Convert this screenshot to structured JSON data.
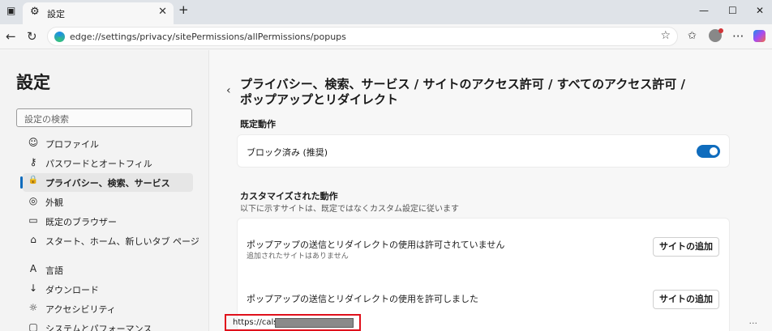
{
  "browser": {
    "tab_title": "設定",
    "tab_close": "✕",
    "new_tab": "+",
    "url": "edge://settings/privacy/sitePermissions/allPermissions/popups"
  },
  "sidebar": {
    "title": "設定",
    "search_placeholder": "設定の検索",
    "items": [
      {
        "label": "プロファイル",
        "icon": "profile-icon",
        "glyph": "☺"
      },
      {
        "label": "パスワードとオートフィル",
        "icon": "key-icon",
        "glyph": "⚷"
      },
      {
        "label": "プライバシー、検索、サービス",
        "icon": "lock-icon",
        "glyph": "🔒"
      },
      {
        "label": "外観",
        "icon": "palette-icon",
        "glyph": "◎"
      },
      {
        "label": "既定のブラウザー",
        "icon": "browser-icon",
        "glyph": "▭"
      },
      {
        "label": "スタート、ホーム、新しいタブ ページ",
        "icon": "home-icon",
        "glyph": "⌂"
      },
      {
        "label": "言語",
        "icon": "language-icon",
        "glyph": "A"
      },
      {
        "label": "ダウンロード",
        "icon": "download-icon",
        "glyph": "↓"
      },
      {
        "label": "アクセシビリティ",
        "icon": "accessibility-icon",
        "glyph": "☼"
      },
      {
        "label": "システムとパフォーマンス",
        "icon": "system-icon",
        "glyph": "▢"
      }
    ]
  },
  "main": {
    "breadcrumb_line1": "プライバシー、検索、サービス / サイトのアクセス許可 / すべてのアクセス許可 /",
    "breadcrumb_line2": "ポップアップとリダイレクト",
    "default_section": "既定動作",
    "default_setting": "ブロック済み (推奨)",
    "default_toggle_on": true,
    "custom_section": "カスタマイズされた動作",
    "custom_description": "以下に示すサイトは、既定ではなくカスタム設定に従います",
    "blocked_title": "ポップアップの送信とリダイレクトの使用は許可されていません",
    "blocked_sub": "追加されたサイトはありません",
    "add_site_label": "サイトの追加",
    "allowed_title": "ポップアップの送信とリダイレクトの使用を許可しました",
    "allowed_site": "https://cals01",
    "more_label": "···"
  },
  "colors": {
    "accent": "#0f6cbd",
    "highlight_border": "#e0101b"
  }
}
